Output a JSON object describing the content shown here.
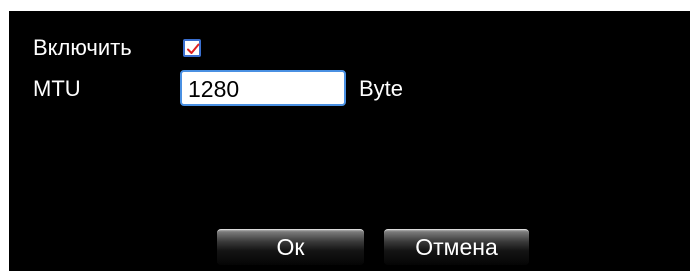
{
  "settings": {
    "enable_label": "Включить",
    "enable_checked": true,
    "mtu_label": "MTU",
    "mtu_value": "1280",
    "unit_label": "Byte"
  },
  "buttons": {
    "ok_label": "Ок",
    "cancel_label": "Отмена"
  },
  "colors": {
    "dialog_background": "#000000",
    "checkmark": "#e02020",
    "input_border": "#4a90e2"
  },
  "icons": {
    "checkbox": "checkmark-icon"
  }
}
